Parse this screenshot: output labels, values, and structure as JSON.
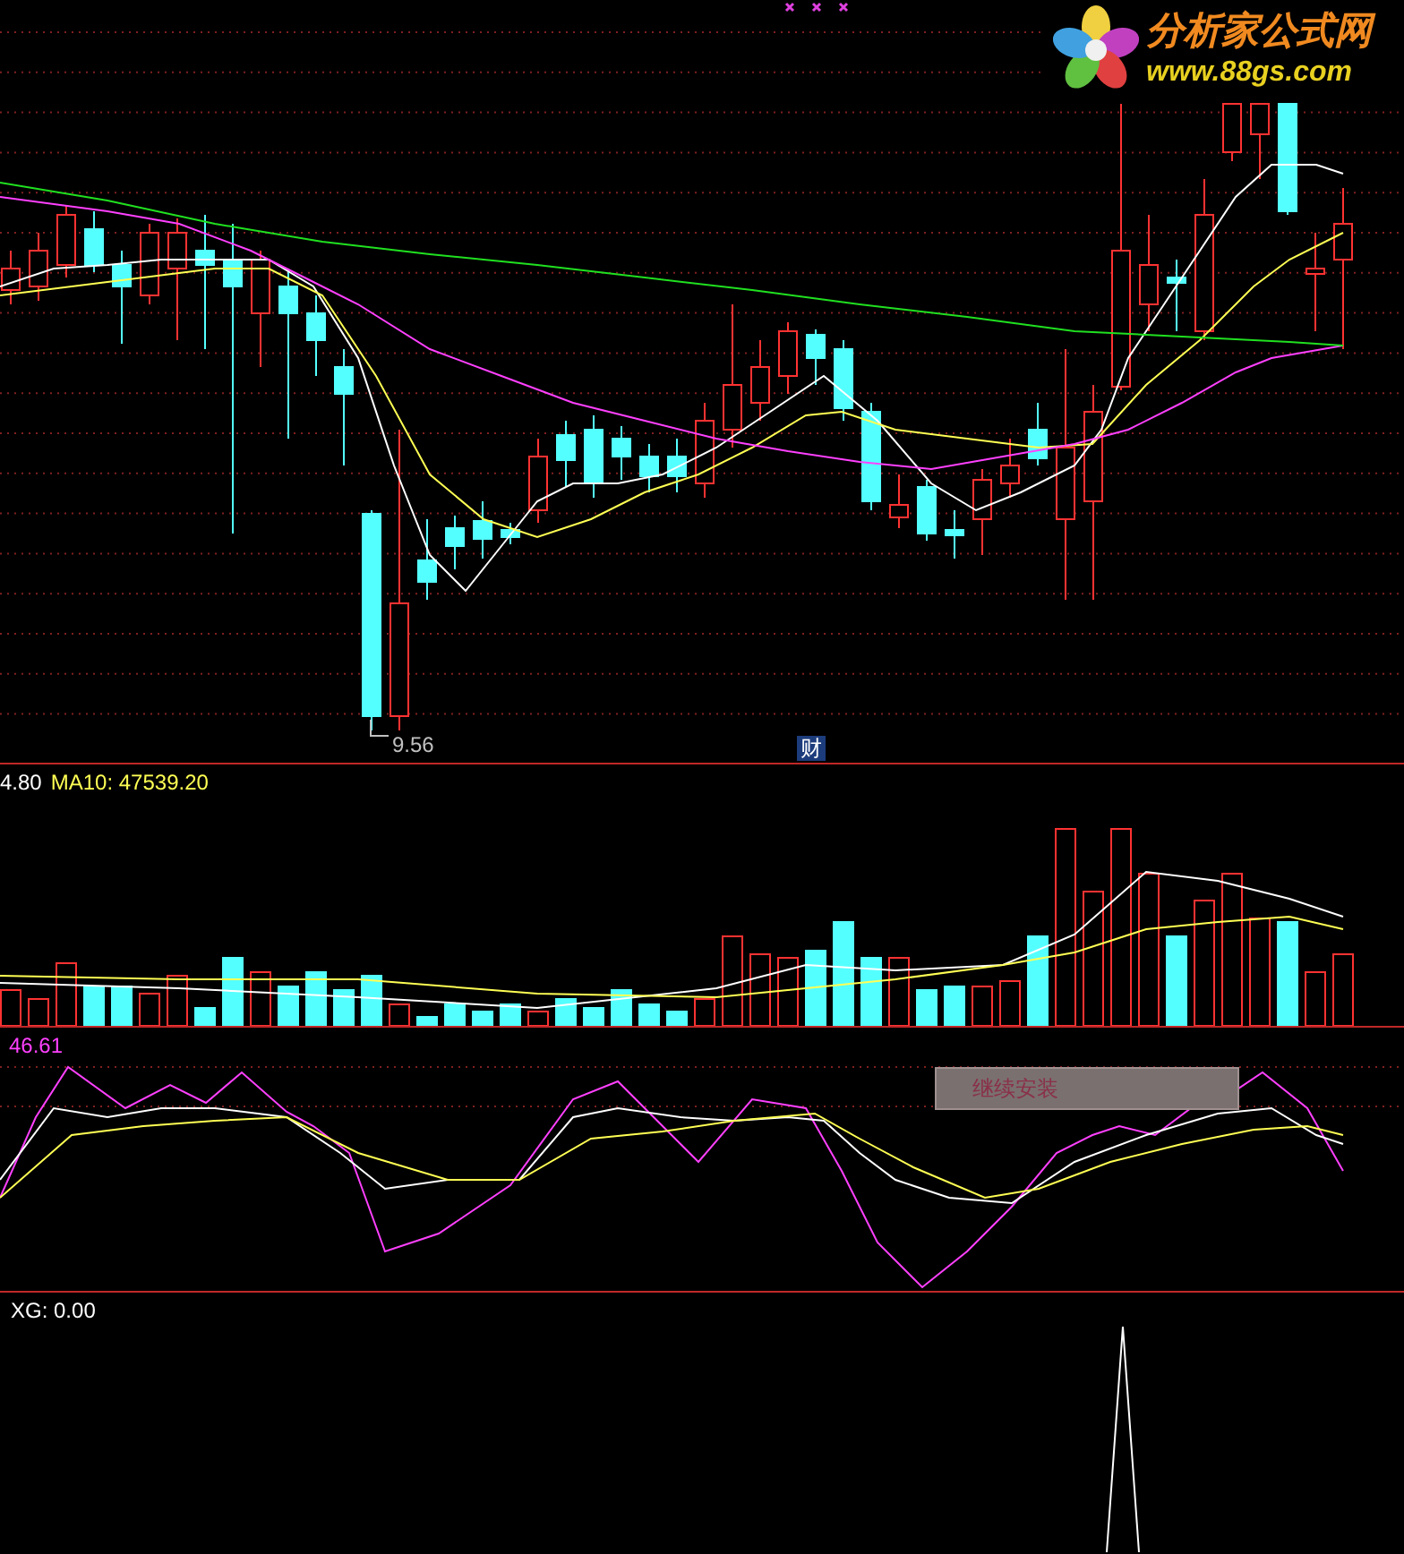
{
  "logo": {
    "title": "分析家公式网",
    "url": "www.88gs.com"
  },
  "main_chart": {
    "low_label": "9.56",
    "marker": "财"
  },
  "volume_panel": {
    "value": "4.80",
    "ma10": "MA10: 47539.20"
  },
  "indicator_panel": {
    "value": "46.61",
    "button": "继续安装"
  },
  "xg_panel": {
    "label": "XG: 0.00"
  }
}
